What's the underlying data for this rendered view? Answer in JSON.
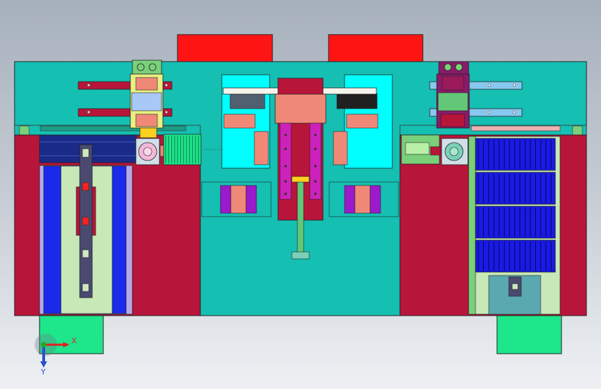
{
  "viewport": {
    "name": "cad-3d-viewport",
    "background_colors": [
      "#a6b0bc",
      "#eef0f3"
    ]
  },
  "triad": {
    "x_label": "X",
    "y_label": "Y",
    "x_color": "#e02020",
    "y_color": "#2a4fd0",
    "origin_color": "#22aa22"
  },
  "palette": {
    "base_teal": "#15bfb2",
    "crimson": "#b8153a",
    "red_cover": "#ff1414",
    "cyan_block": "#00ffff",
    "mint_foot": "#1ee68a",
    "salmon": "#f08878",
    "magenta_rail": "#cc22bb",
    "navy_panel": "#1a2a88",
    "purple_block": "#9a1acc",
    "pale_green": "#c8e8b8",
    "blue_strip": "#1a2ae8"
  },
  "roller_count": 4
}
